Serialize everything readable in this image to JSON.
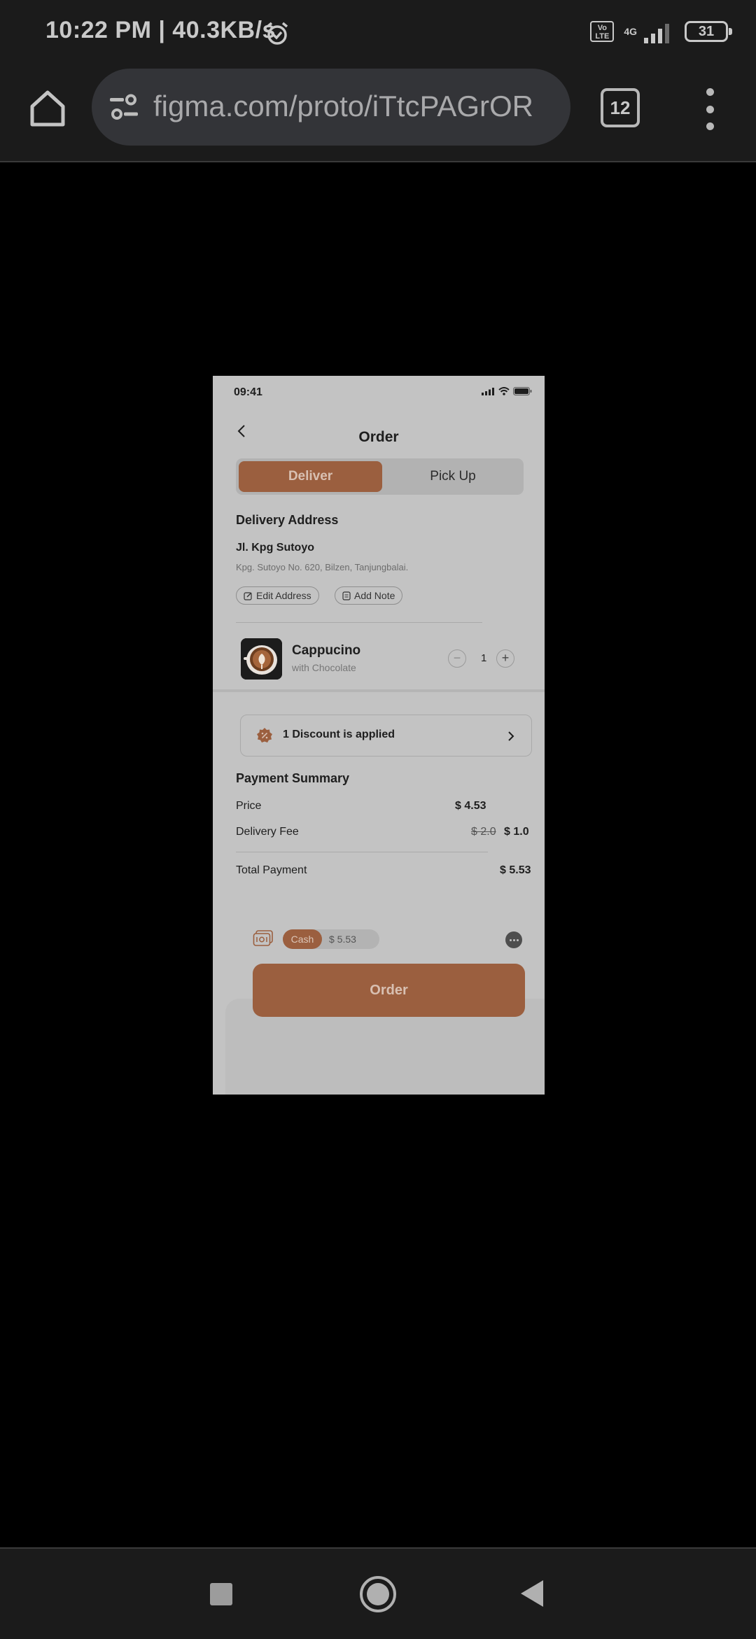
{
  "system_status": {
    "time": "10:22 PM | 40.3KB/s",
    "volte": "Vo LTE",
    "network": "4G",
    "battery": "31"
  },
  "browser": {
    "url": "figma.com/proto/iTtcPAGrOR",
    "tab_count": "12"
  },
  "app": {
    "status_time": "09:41",
    "title": "Order",
    "tabs": [
      {
        "label": "Deliver",
        "active": true
      },
      {
        "label": "Pick Up",
        "active": false
      }
    ],
    "delivery_address": {
      "heading": "Delivery Address",
      "name": "Jl. Kpg Sutoyo",
      "detail": "Kpg. Sutoyo No. 620, Bilzen, Tanjungbalai.",
      "edit_label": "Edit Address",
      "note_label": "Add Note"
    },
    "product": {
      "name": "Cappucino",
      "subtitle": "with Chocolate",
      "quantity": "1",
      "minus": "−",
      "plus": "+"
    },
    "discount": {
      "text": "1 Discount is applied"
    },
    "payment_summary": {
      "heading": "Payment Summary",
      "price_label": "Price",
      "price_value": "$ 4.53",
      "delivery_label": "Delivery Fee",
      "delivery_original": "$ 2.0",
      "delivery_value": "$ 1.0",
      "total_label": "Total Payment",
      "total_value": "$ 5.53"
    },
    "payment_method": {
      "label": "Cash",
      "amount": "$ 5.53"
    },
    "order_button": "Order"
  },
  "colors": {
    "accent": "#9b5f3f",
    "frame_bg": "#c3c3c3",
    "chrome_bg": "#1b1b1b"
  }
}
